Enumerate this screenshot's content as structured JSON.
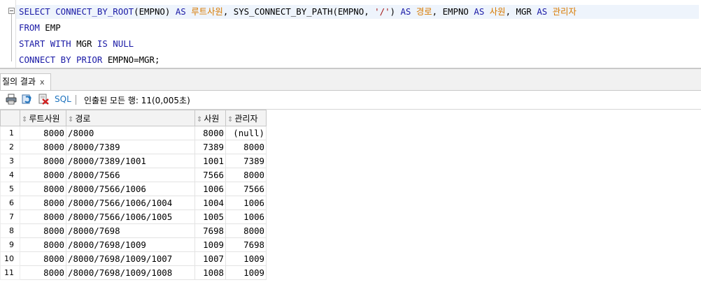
{
  "editor": {
    "lines": [
      {
        "segments": [
          {
            "t": "SELECT CONNECT_BY_ROOT",
            "c": "kw"
          },
          {
            "t": "(EMPNO) ",
            "c": ""
          },
          {
            "t": "AS",
            "c": "kw"
          },
          {
            "t": " ",
            "c": ""
          },
          {
            "t": "루트사원",
            "c": "ko"
          },
          {
            "t": ", SYS_CONNECT_BY_PATH(EMPNO, ",
            "c": ""
          },
          {
            "t": "'/'",
            "c": "str"
          },
          {
            "t": ") ",
            "c": ""
          },
          {
            "t": "AS",
            "c": "kw"
          },
          {
            "t": " ",
            "c": ""
          },
          {
            "t": "경로",
            "c": "ko"
          },
          {
            "t": ", EMPNO ",
            "c": ""
          },
          {
            "t": "AS",
            "c": "kw"
          },
          {
            "t": " ",
            "c": ""
          },
          {
            "t": "사원",
            "c": "ko"
          },
          {
            "t": ", MGR ",
            "c": ""
          },
          {
            "t": "AS",
            "c": "kw"
          },
          {
            "t": " ",
            "c": ""
          },
          {
            "t": "관리자",
            "c": "ko"
          }
        ]
      },
      {
        "segments": [
          {
            "t": "FROM",
            "c": "kw"
          },
          {
            "t": " EMP",
            "c": ""
          }
        ]
      },
      {
        "segments": [
          {
            "t": "START WITH",
            "c": "kw"
          },
          {
            "t": " MGR ",
            "c": ""
          },
          {
            "t": "IS NULL",
            "c": "kw"
          }
        ]
      },
      {
        "segments": [
          {
            "t": "CONNECT BY PRIOR",
            "c": "kw"
          },
          {
            "t": " EMPNO=MGR;",
            "c": ""
          }
        ]
      }
    ]
  },
  "results_tab": {
    "label": "질의 결과",
    "close": "x"
  },
  "toolbar": {
    "print_icon": "print-icon",
    "refresh_icon": "refresh-icon",
    "delete_icon": "delete-icon",
    "sql_label": "SQL",
    "status": "인출된 모든 행: 11(0,005초)"
  },
  "grid": {
    "columns": [
      "루트사원",
      "경로",
      "사원",
      "관리자"
    ],
    "rows": [
      [
        "1",
        "8000",
        "/8000",
        "8000",
        "(null)"
      ],
      [
        "2",
        "8000",
        "/8000/7389",
        "7389",
        "8000"
      ],
      [
        "3",
        "8000",
        "/8000/7389/1001",
        "1001",
        "7389"
      ],
      [
        "4",
        "8000",
        "/8000/7566",
        "7566",
        "8000"
      ],
      [
        "5",
        "8000",
        "/8000/7566/1006",
        "1006",
        "7566"
      ],
      [
        "6",
        "8000",
        "/8000/7566/1006/1004",
        "1004",
        "1006"
      ],
      [
        "7",
        "8000",
        "/8000/7566/1006/1005",
        "1005",
        "1006"
      ],
      [
        "8",
        "8000",
        "/8000/7698",
        "7698",
        "8000"
      ],
      [
        "9",
        "8000",
        "/8000/7698/1009",
        "1009",
        "7698"
      ],
      [
        "10",
        "8000",
        "/8000/7698/1009/1007",
        "1007",
        "1009"
      ],
      [
        "11",
        "8000",
        "/8000/7698/1009/1008",
        "1008",
        "1009"
      ]
    ]
  }
}
